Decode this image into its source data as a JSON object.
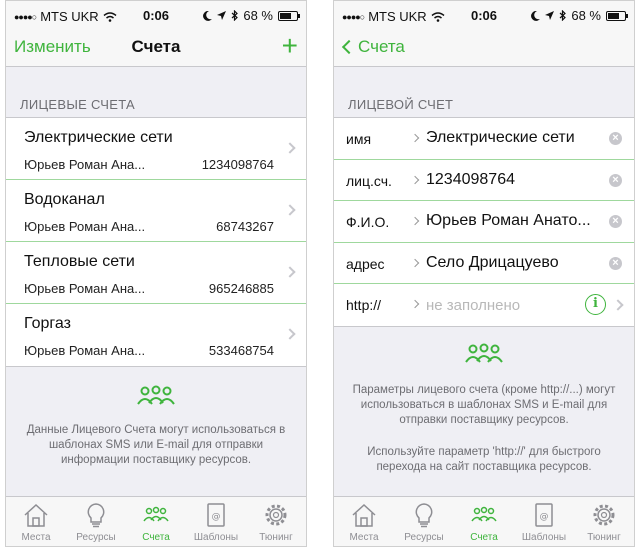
{
  "colors": {
    "accent": "#3fb43d",
    "divider": "#9fd89d",
    "muted": "#6d6d72"
  },
  "status": {
    "signal": "●●●●○",
    "carrier": "MTS UKR",
    "time": "0:06",
    "battery": "68 %",
    "battery_level": 0.68
  },
  "left": {
    "nav": {
      "edit": "Изменить",
      "title": "Счета",
      "add": "+"
    },
    "section": "ЛИЦЕВЫЕ СЧЕТА",
    "accounts": [
      {
        "title": "Электрические сети",
        "owner": "Юрьев Роман Ана...",
        "number": "1234098764"
      },
      {
        "title": "Водоканал",
        "owner": "Юрьев Роман Ана...",
        "number": "68743267"
      },
      {
        "title": "Тепловые сети",
        "owner": "Юрьев Роман Ана...",
        "number": "965246885"
      },
      {
        "title": "Горгаз",
        "owner": "Юрьев Роман Ана...",
        "number": "533468754"
      }
    ],
    "info": "Данные Лицевого Счета могут использоваться в шаблонах SMS или E-mail для отправки информации поставщику ресурсов."
  },
  "right": {
    "nav": {
      "back": "Счета"
    },
    "section": "ЛИЦЕВОЙ СЧЕТ",
    "fields": [
      {
        "label": "имя",
        "value": "Электрические сети"
      },
      {
        "label": "лиц.сч.",
        "value": "1234098764"
      },
      {
        "label": "Ф.И.О.",
        "value": "Юрьев Роман Анато..."
      },
      {
        "label": "адрес",
        "value": "Село Дрицацуево"
      },
      {
        "label": "http://",
        "placeholder": "не заполнено"
      }
    ],
    "info1": "Параметры лицевого счета (кроме http://...) могут использоваться в шаблонах SMS и E-mail для отправки поставщику ресурсов.",
    "info2": "Используйте параметр 'http://' для быстрого перехода на сайт поставщика ресурсов."
  },
  "tabs": [
    {
      "label": "Места",
      "icon": "house-icon"
    },
    {
      "label": "Ресурсы",
      "icon": "lightbulb-icon"
    },
    {
      "label": "Счета",
      "icon": "people-icon"
    },
    {
      "label": "Шаблоны",
      "icon": "mail-template-icon"
    },
    {
      "label": "Тюнинг",
      "icon": "gear-icon"
    }
  ]
}
